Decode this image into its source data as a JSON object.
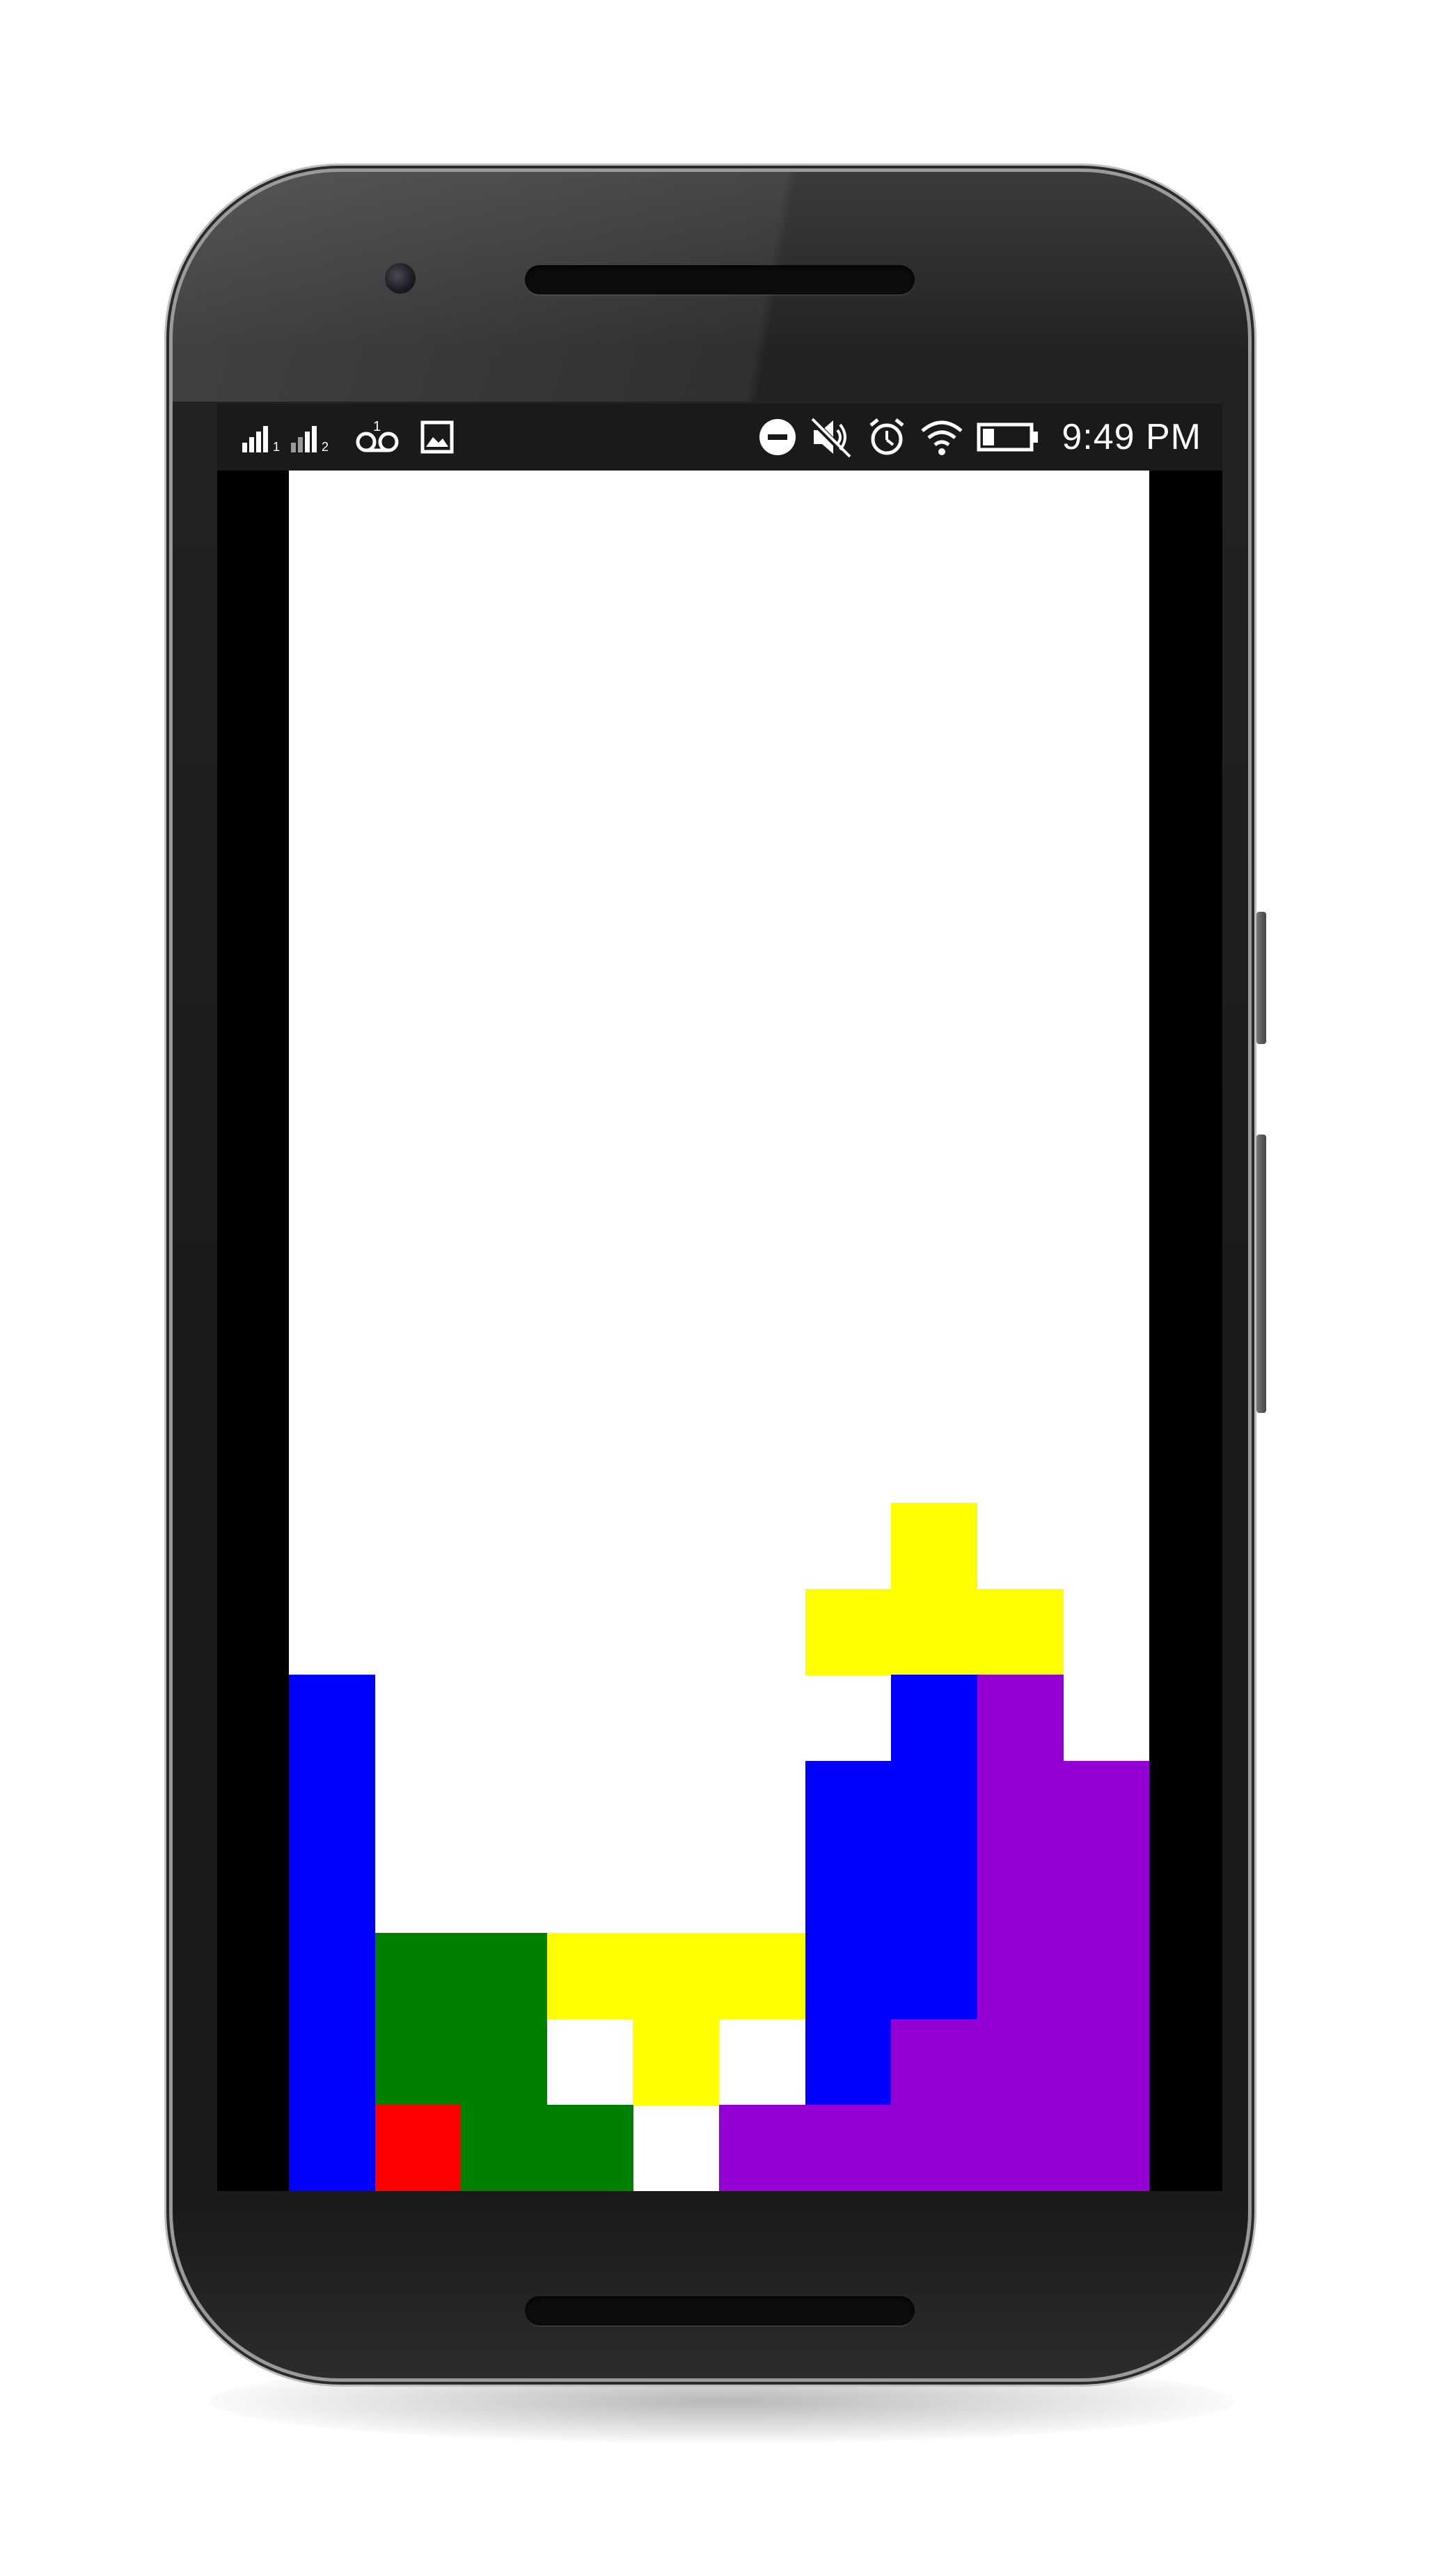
{
  "status_bar": {
    "time": "9:49 PM",
    "sim1_label": "1",
    "sim2_label": "2",
    "icons": [
      "signal-sim1-icon",
      "signal-sim2-icon",
      "voicemail-icon",
      "image-icon",
      "do-not-disturb-icon",
      "mute-icon",
      "alarm-icon",
      "wifi-icon",
      "battery-icon"
    ]
  },
  "game": {
    "columns": 10,
    "rows": 20,
    "colors": {
      "blue": "#0000ff",
      "green": "#008000",
      "yellow": "#ffff00",
      "red": "#ff0000",
      "purple": "#9400d3",
      "empty": "#ffffff"
    },
    "cells": [
      {
        "r": 12,
        "c": 7,
        "color": "yellow"
      },
      {
        "r": 13,
        "c": 6,
        "color": "yellow"
      },
      {
        "r": 13,
        "c": 7,
        "color": "yellow"
      },
      {
        "r": 13,
        "c": 8,
        "color": "yellow"
      },
      {
        "r": 14,
        "c": 0,
        "color": "blue"
      },
      {
        "r": 14,
        "c": 7,
        "color": "blue"
      },
      {
        "r": 14,
        "c": 8,
        "color": "purple"
      },
      {
        "r": 15,
        "c": 0,
        "color": "blue"
      },
      {
        "r": 15,
        "c": 6,
        "color": "blue"
      },
      {
        "r": 15,
        "c": 7,
        "color": "blue"
      },
      {
        "r": 15,
        "c": 8,
        "color": "purple"
      },
      {
        "r": 15,
        "c": 9,
        "color": "purple"
      },
      {
        "r": 16,
        "c": 0,
        "color": "blue"
      },
      {
        "r": 16,
        "c": 6,
        "color": "blue"
      },
      {
        "r": 16,
        "c": 7,
        "color": "blue"
      },
      {
        "r": 16,
        "c": 8,
        "color": "purple"
      },
      {
        "r": 16,
        "c": 9,
        "color": "purple"
      },
      {
        "r": 17,
        "c": 0,
        "color": "blue"
      },
      {
        "r": 17,
        "c": 1,
        "color": "green"
      },
      {
        "r": 17,
        "c": 2,
        "color": "green"
      },
      {
        "r": 17,
        "c": 3,
        "color": "yellow"
      },
      {
        "r": 17,
        "c": 4,
        "color": "yellow"
      },
      {
        "r": 17,
        "c": 5,
        "color": "yellow"
      },
      {
        "r": 17,
        "c": 6,
        "color": "blue"
      },
      {
        "r": 17,
        "c": 7,
        "color": "blue"
      },
      {
        "r": 17,
        "c": 8,
        "color": "purple"
      },
      {
        "r": 17,
        "c": 9,
        "color": "purple"
      },
      {
        "r": 18,
        "c": 0,
        "color": "blue"
      },
      {
        "r": 18,
        "c": 1,
        "color": "green"
      },
      {
        "r": 18,
        "c": 2,
        "color": "green"
      },
      {
        "r": 18,
        "c": 4,
        "color": "yellow"
      },
      {
        "r": 18,
        "c": 6,
        "color": "blue"
      },
      {
        "r": 18,
        "c": 7,
        "color": "purple"
      },
      {
        "r": 18,
        "c": 8,
        "color": "purple"
      },
      {
        "r": 18,
        "c": 9,
        "color": "purple"
      },
      {
        "r": 19,
        "c": 0,
        "color": "blue"
      },
      {
        "r": 19,
        "c": 1,
        "color": "red"
      },
      {
        "r": 19,
        "c": 2,
        "color": "green"
      },
      {
        "r": 19,
        "c": 3,
        "color": "green"
      },
      {
        "r": 19,
        "c": 5,
        "color": "purple"
      },
      {
        "r": 19,
        "c": 6,
        "color": "purple"
      },
      {
        "r": 19,
        "c": 7,
        "color": "purple"
      },
      {
        "r": 19,
        "c": 8,
        "color": "purple"
      },
      {
        "r": 19,
        "c": 9,
        "color": "purple"
      }
    ]
  }
}
